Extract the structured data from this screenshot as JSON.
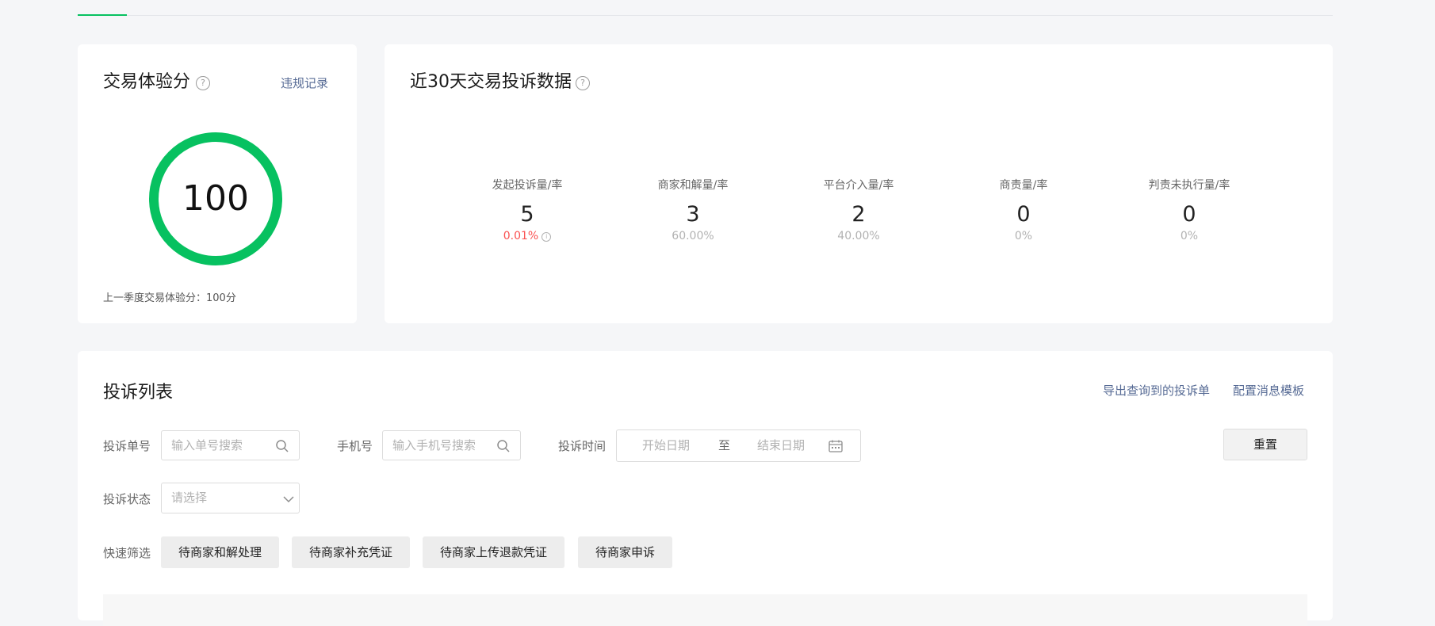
{
  "score_card": {
    "title": "交易体验分",
    "help": "?",
    "violation_link": "违规记录",
    "score": "100",
    "last_quarter": "上一季度交易体验分：100分",
    "ring_color": "#07c160"
  },
  "stats_card": {
    "title": "近30天交易投诉数据",
    "help": "?",
    "items": [
      {
        "label": "发起投诉量/率",
        "value": "5",
        "rate": "0.01%",
        "rate_color": "#fa5151",
        "info_icon": "i"
      },
      {
        "label": "商家和解量/率",
        "value": "3",
        "rate": "60.00%"
      },
      {
        "label": "平台介入量/率",
        "value": "2",
        "rate": "40.00%"
      },
      {
        "label": "商责量/率",
        "value": "0",
        "rate": "0%"
      },
      {
        "label": "判责未执行量/率",
        "value": "0",
        "rate": "0%"
      }
    ]
  },
  "list_card": {
    "title": "投诉列表",
    "export_link": "导出查询到的投诉单",
    "template_link": "配置消息模板",
    "filters": {
      "order_label": "投诉单号",
      "order_placeholder": "输入单号搜索",
      "phone_label": "手机号",
      "phone_placeholder": "输入手机号搜索",
      "time_label": "投诉时间",
      "start_placeholder": "开始日期",
      "range_sep": "至",
      "end_placeholder": "结束日期",
      "status_label": "投诉状态",
      "status_placeholder": "请选择",
      "reset_label": "重置",
      "quick_label": "快速筛选",
      "quick_chips": [
        "待商家和解处理",
        "待商家补充凭证",
        "待商家上传退款凭证",
        "待商家申诉"
      ]
    }
  }
}
